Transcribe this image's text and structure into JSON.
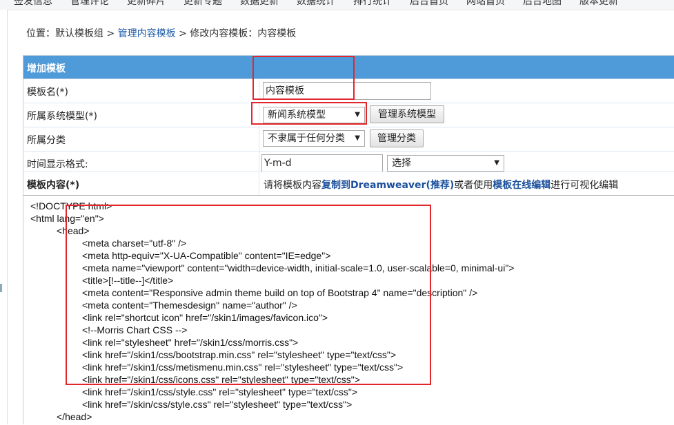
{
  "topnav": [
    "签发信息",
    "管理评论",
    "更新碎片",
    "更新专题",
    "数据更新",
    "数据统计",
    "排行统计",
    "后台首页",
    "网站首页",
    "后台地图",
    "版本更新"
  ],
  "breadcrumb": {
    "prefix": "位置：默认模板组 > ",
    "link": "管理内容模板",
    "suffix": " > 修改内容模板：内容模板"
  },
  "form": {
    "header": "增加模板",
    "name_label": "模板名(*)",
    "name_value": "内容模板",
    "model_label": "所属系统模型(*)",
    "model_value": "新闻系统模型",
    "model_button": "管理系统模型",
    "class_label": "所属分类",
    "class_value": "不隶属于任何分类",
    "class_button": "管理分类",
    "time_label": "时间显示格式:",
    "time_value": "Y-m-d",
    "time_select": "选择",
    "content_label": "模板内容(*)",
    "tip_pre": "请将模板内容",
    "tip_link1": "复制到Dreamweaver(推荐)",
    "tip_mid": "或者使用",
    "tip_link2": "模板在线编辑",
    "tip_post": "进行可视化编辑"
  },
  "code_lines": [
    "<!DOCTYPE html>",
    "<html lang=\"en\">",
    "<head>",
    "<meta charset=\"utf-8\" />",
    "<meta http-equiv=\"X-UA-Compatible\" content=\"IE=edge\">",
    "<meta name=\"viewport\" content=\"width=device-width, initial-scale=1.0, user-scalable=0, minimal-ui\">",
    "<title>[!--title--]</title>",
    "<meta content=\"Responsive admin theme build on top of Bootstrap 4\" name=\"description\" />",
    "<meta content=\"Themesdesign\" name=\"author\" />",
    "<link rel=\"shortcut icon\" href=\"/skin1/images/favicon.ico\">",
    "<!--Morris Chart CSS -->",
    "<link rel=\"stylesheet\" href=\"/skin1/css/morris.css\">",
    "<link href=\"/skin1/css/bootstrap.min.css\" rel=\"stylesheet\" type=\"text/css\">",
    "<link href=\"/skin1/css/metismenu.min.css\" rel=\"stylesheet\" type=\"text/css\">",
    "<link href=\"/skin1/css/icons.css\" rel=\"stylesheet\" type=\"text/css\">",
    "<link href=\"/skin1/css/style.css\" rel=\"stylesheet\" type=\"text/css\">",
    "<link href=\"/skin/css/style.css\" rel=\"stylesheet\" type=\"text/css\">",
    "</head>"
  ],
  "colors": {
    "header_bg": "#4f9ad9",
    "highlight": "#e2262b",
    "link": "#1a5aa6"
  }
}
